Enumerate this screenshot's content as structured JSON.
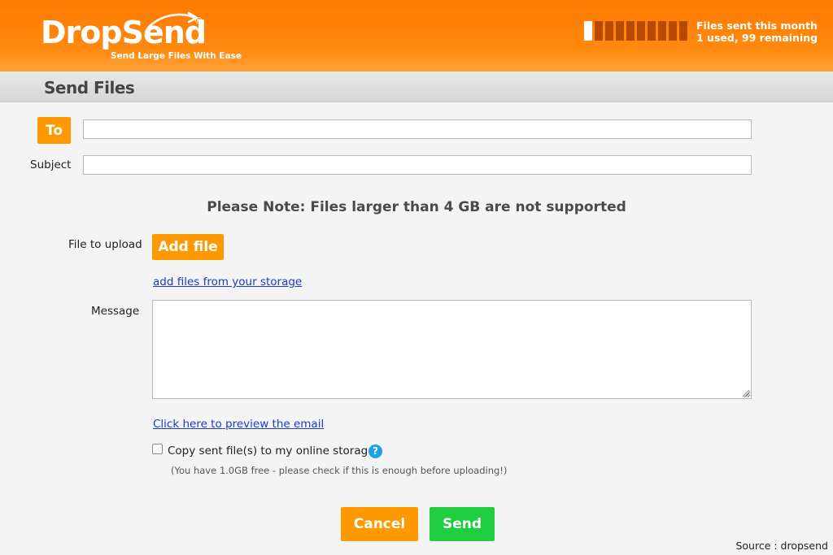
{
  "header": {
    "logo_text": "DropSend",
    "logo_reg": "®",
    "tagline": "Send Large Files With Ease",
    "usage_meter": {
      "used": 1,
      "total": 100
    },
    "files_stat_line1": "Files sent this month",
    "files_stat_line2": "1 used, 99 remaining",
    "colors": {
      "brand_orange": "#ff7a00",
      "meter_used": "#ffffff",
      "meter_empty": "#b84a00"
    }
  },
  "page": {
    "title": "Send Files"
  },
  "form": {
    "to_button": "To",
    "to_value": "",
    "subject_label": "Subject",
    "subject_value": "",
    "note": "Please Note: Files larger than 4 GB are not supported",
    "file_label": "File to upload",
    "add_file_button": "Add file",
    "storage_link": "add files from your storage",
    "message_label": "Message",
    "message_value": "",
    "preview_link": "Click here to preview the email",
    "copy_checkbox_label": "Copy sent file(s) to my online storage",
    "copy_checked": false,
    "help_icon": "?",
    "storage_hint": "(You have 1.0GB free - please check if this is enough before uploading!)"
  },
  "actions": {
    "cancel": "Cancel",
    "send": "Send",
    "colors": {
      "cancel": "#ff9900",
      "send": "#1fce3f"
    }
  },
  "footer": {
    "source": "Source : dropsend"
  }
}
